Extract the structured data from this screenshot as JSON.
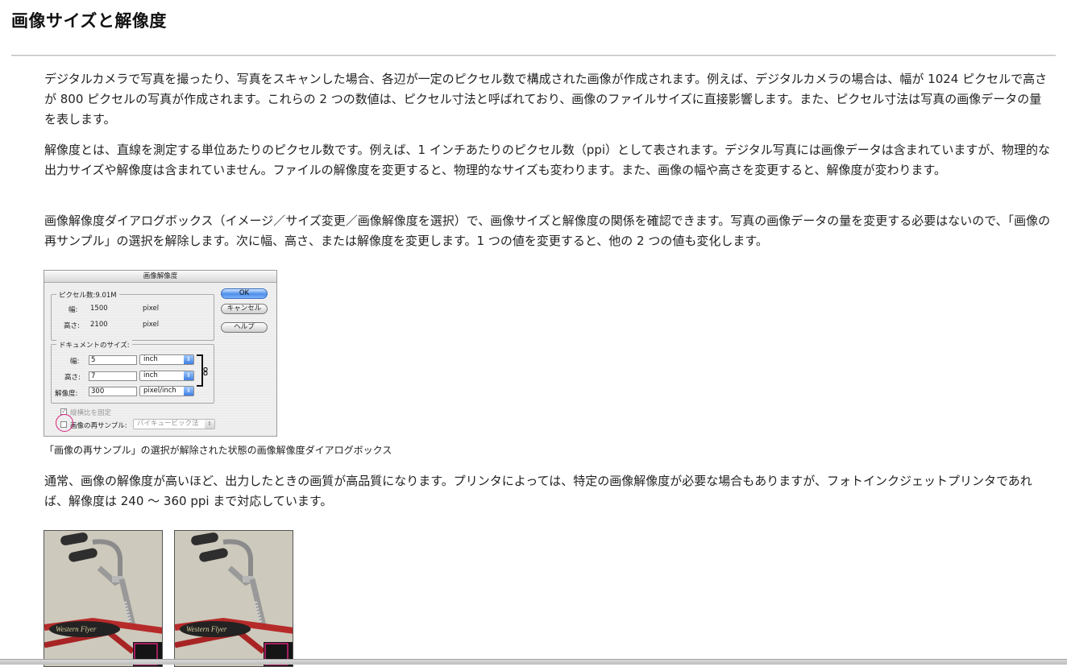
{
  "page": {
    "title": "画像サイズと解像度"
  },
  "paragraphs": [
    "デジタルカメラで写真を撮ったり、写真をスキャンした場合、各辺が一定のピクセル数で構成された画像が作成されます。例えば、デジタルカメラの場合は、幅が 1024 ピクセルで高さが 800 ピクセルの写真が作成されます。これらの 2 つの数値は、ピクセル寸法と呼ばれており、画像のファイルサイズに直接影響します。また、ピクセル寸法は写真の画像データの量を表します。",
    "解像度とは、直線を測定する単位あたりのピクセル数です。例えば、1 インチあたりのピクセル数（ppi）として表されます。デジタル写真には画像データは含まれていますが、物理的な出力サイズや解像度は含まれていません。ファイルの解像度を変更すると、物理的なサイズも変わります。また、画像の幅や高さを変更すると、解像度が変わります。",
    "画像解像度ダイアログボックス（イメージ／サイズ変更／画像解像度を選択）で、画像サイズと解像度の関係を確認できます。写真の画像データの量を変更する必要はないので、「画像の再サンプル」の選択を解除します。次に幅、高さ、または解像度を変更します。1 つの値を変更すると、他の 2 つの値も変化します。",
    "通常、画像の解像度が高いほど、出力したときの画質が高品質になります。プリンタによっては、特定の画像解像度が必要な場合もありますが、フォトインクジェットプリンタであれば、解像度は 240 ～ 360 ppi まで対応しています。"
  ],
  "dialog": {
    "title": "画像解像度",
    "pixel_group": {
      "legend": "ピクセル数:9.01M",
      "width_label": "幅:",
      "width_value": "1500",
      "width_unit": "pixel",
      "height_label": "高さ:",
      "height_value": "2100",
      "height_unit": "pixel"
    },
    "document_group": {
      "legend": "ドキュメントのサイズ:",
      "width_label": "幅:",
      "width_value": "5",
      "width_unit": "inch",
      "height_label": "高さ:",
      "height_value": "7",
      "height_unit": "inch",
      "resolution_label": "解像度:",
      "resolution_value": "300",
      "resolution_unit": "pixel/inch"
    },
    "buttons": {
      "ok": "OK",
      "cancel": "キャンセル",
      "help": "ヘルプ"
    },
    "constrain_label": "縦横比を固定",
    "constrain_checked": true,
    "resample_label": "画像の再サンプル:",
    "resample_checked": false,
    "resample_method": "バイキュービック法"
  },
  "figure_caption": "「画像の再サンプル」の選択が解除された状態の画像解像度ダイアログボックス",
  "colors": {
    "highlight": "#d4237a",
    "ok_button": "#4d8ee8"
  }
}
